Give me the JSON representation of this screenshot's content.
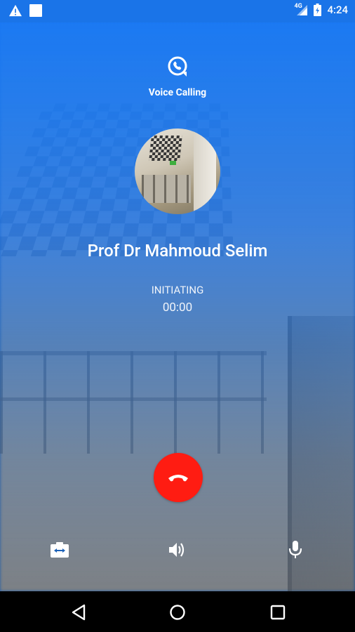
{
  "status_bar": {
    "network_type": "4G",
    "time": "4:24"
  },
  "header": {
    "title": "Voice Calling"
  },
  "call": {
    "caller_name": "Prof Dr Mahmoud Selim",
    "status": "INITIATING",
    "timer": "00:00"
  },
  "controls": {
    "icons": [
      "switch-camera-icon",
      "speaker-icon",
      "microphone-icon"
    ],
    "end_call_icon": "phone-hangup-icon",
    "end_call_color": "#ff1c12"
  },
  "colors": {
    "accent": "#1a74e8"
  },
  "nav": {
    "icons": [
      "back-icon",
      "home-icon",
      "recents-icon"
    ]
  }
}
